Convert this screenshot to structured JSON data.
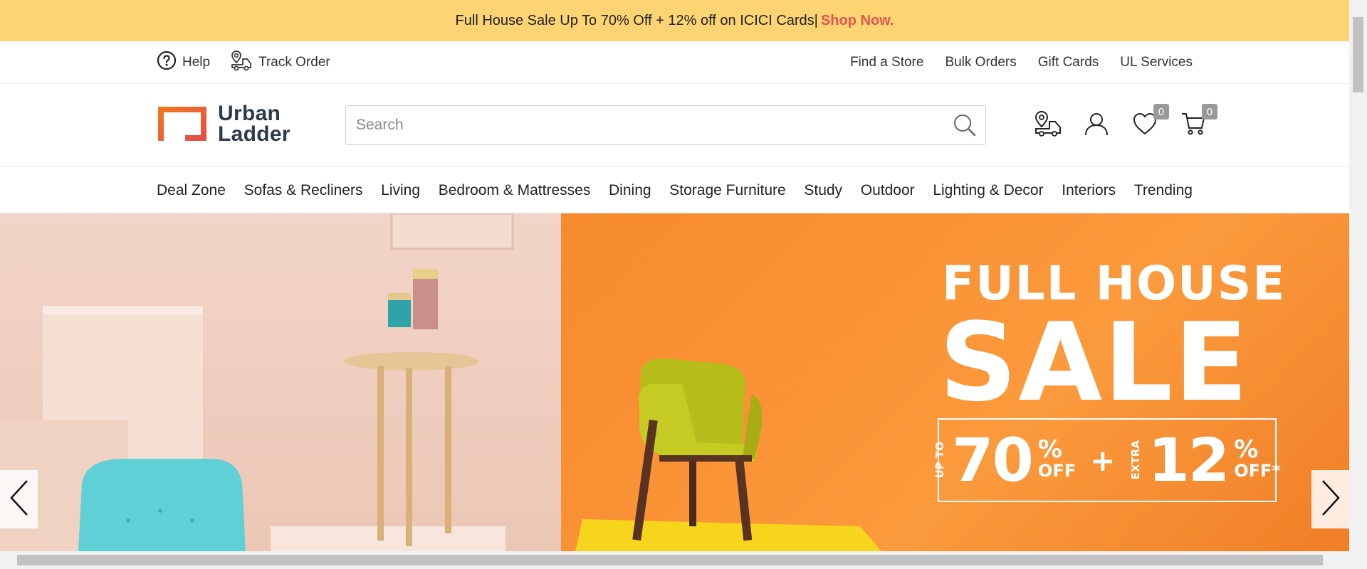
{
  "promo": {
    "text": "Full House Sale Up To 70% Off + 12% off on ICICI Cards|",
    "link": "Shop Now."
  },
  "utility": {
    "help": "Help",
    "track_order": "Track Order",
    "right_links": [
      "Find a Store",
      "Bulk Orders",
      "Gift Cards",
      "UL Services"
    ]
  },
  "header": {
    "logo_line1": "Urban",
    "logo_line2": "Ladder",
    "search_placeholder": "Search",
    "wishlist_count": "0",
    "cart_count": "0"
  },
  "nav": {
    "items": [
      "Deal Zone",
      "Sofas & Recliners",
      "Living",
      "Bedroom & Mattresses",
      "Dining",
      "Storage Furniture",
      "Study",
      "Outdoor",
      "Lighting & Decor",
      "Interiors",
      "Trending"
    ]
  },
  "hero": {
    "line1": "FULL HOUSE",
    "line2": "SALE",
    "offer1_side": "UP TO",
    "offer1_value": "70",
    "offer1_pct": "%",
    "offer1_off": "OFF",
    "plus": "+",
    "offer2_side": "EXTRA",
    "offer2_value": "12",
    "offer2_pct": "%",
    "offer2_off": "OFF*"
  },
  "colors": {
    "promo_bg": "#fdd474",
    "promo_link": "#e2564e",
    "hero_orange": "#f78a2e",
    "brand_text": "#2d3a4b"
  }
}
